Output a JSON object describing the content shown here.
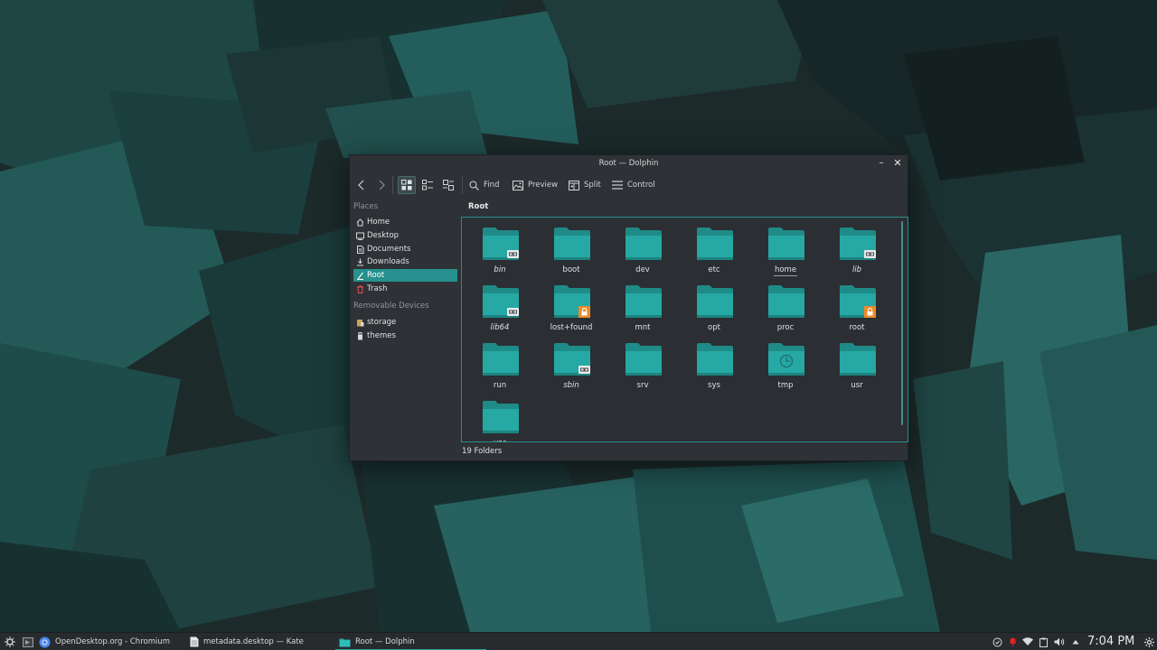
{
  "window": {
    "title": "Root — Dolphin",
    "minimize_glyph": "–",
    "close_glyph": "✕"
  },
  "toolbar": {
    "back_icon": "chevron-left-icon",
    "forward_icon": "chevron-right-icon",
    "view_modes": [
      "icons-view",
      "compact-view",
      "details-view"
    ],
    "find": "Find",
    "preview": "Preview",
    "split": "Split",
    "control": "Control"
  },
  "sidebar": {
    "places_heading": "Places",
    "places": [
      {
        "label": "Home",
        "icon": "home-icon"
      },
      {
        "label": "Desktop",
        "icon": "desktop-icon"
      },
      {
        "label": "Documents",
        "icon": "documents-icon"
      },
      {
        "label": "Downloads",
        "icon": "downloads-icon"
      },
      {
        "label": "Root",
        "icon": "root-icon",
        "active": true
      },
      {
        "label": "Trash",
        "icon": "trash-icon"
      }
    ],
    "devices_heading": "Removable Devices",
    "devices": [
      {
        "label": "storage",
        "icon": "storage-icon"
      },
      {
        "label": "themes",
        "icon": "usb-drive-icon"
      }
    ]
  },
  "location": "Root",
  "folders": [
    {
      "name": "bin",
      "emblem": "symlink",
      "italic": true
    },
    {
      "name": "boot"
    },
    {
      "name": "dev"
    },
    {
      "name": "etc"
    },
    {
      "name": "home",
      "underline": true
    },
    {
      "name": "lib",
      "emblem": "symlink",
      "italic": true
    },
    {
      "name": "lib64",
      "emblem": "symlink",
      "italic": true
    },
    {
      "name": "lost+found",
      "emblem": "locked"
    },
    {
      "name": "mnt"
    },
    {
      "name": "opt"
    },
    {
      "name": "proc"
    },
    {
      "name": "root",
      "emblem": "locked"
    },
    {
      "name": "run"
    },
    {
      "name": "sbin",
      "emblem": "symlink",
      "italic": true
    },
    {
      "name": "srv"
    },
    {
      "name": "sys"
    },
    {
      "name": "tmp",
      "emblem": "clock"
    },
    {
      "name": "usr"
    },
    {
      "name": "var"
    }
  ],
  "status": "19 Folders",
  "taskbar": {
    "launcher_icon": "kde-launcher-icon",
    "show_desktop_icon": "show-desktop-icon",
    "tasks": [
      {
        "label": "OpenDesktop.org - Chromium",
        "icon": "chromium-icon"
      },
      {
        "label": "metadata.desktop — Kate",
        "icon": "text-file-icon"
      },
      {
        "label": "Root — Dolphin",
        "icon": "folder-icon",
        "active": true
      }
    ],
    "tray_icons": [
      "update-icon",
      "notification-alert-icon",
      "network-wifi-icon",
      "clipboard-icon",
      "volume-icon",
      "expand-tray-icon"
    ],
    "clock": "7:04 PM",
    "settings_icon": "panel-settings-icon"
  },
  "colors": {
    "accent": "#26918e",
    "folder_body": "#26a8a4",
    "folder_tab": "#1f8a87",
    "lock_emblem": "#f08a24",
    "alert": "#e02424"
  }
}
